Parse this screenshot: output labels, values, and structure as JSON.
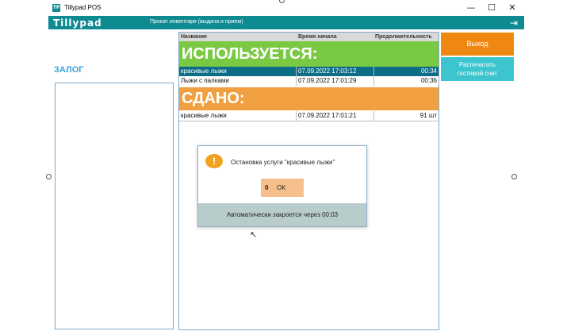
{
  "window": {
    "title": "Tillypad POS",
    "app_icon": "tillypad-icon",
    "minimize": "—",
    "maximize": "☐",
    "close": "✕"
  },
  "appbar": {
    "logo": "Tillypad",
    "title": "Прокат инвентаря (выдача и прием)",
    "exit_icon": "⇥"
  },
  "deposit": {
    "label": "ЗАЛОГ"
  },
  "table": {
    "columns": [
      "Название",
      "Время начала",
      "Продолжительность"
    ],
    "sections": [
      {
        "title": "ИСПОЛЬЗУЕТСЯ:",
        "color": "#7ac943",
        "rows": [
          {
            "name": "красивые лыжи",
            "start": "07.09.2022 17:03:12",
            "duration": "00:34",
            "selected": true
          },
          {
            "name": "Лыжи с палками",
            "start": "07.09.2022 17:01:29",
            "duration": "00:36",
            "selected": false
          }
        ]
      },
      {
        "title": "СДАНО:",
        "color": "#f0a040",
        "rows": [
          {
            "name": "красивые лыжи",
            "start": "07.09.2022 17:01:21",
            "duration": "91 шт",
            "selected": false
          }
        ]
      }
    ]
  },
  "actions": {
    "exit_label": "Выход",
    "print_label_1": "Распечатать",
    "print_label_2": "гостевой счет",
    "exit_color": "#ee8811",
    "print_color": "#3dc5cf"
  },
  "dialog": {
    "icon": "!",
    "message": "Остановка услуги \"красивые лыжи\"",
    "ok_number": "0",
    "ok_label": "ОК",
    "footer": "Автоматически закроется через 00:03"
  },
  "colors": {
    "accent": "#0e8a91",
    "selected_row": "#0e6d86"
  }
}
